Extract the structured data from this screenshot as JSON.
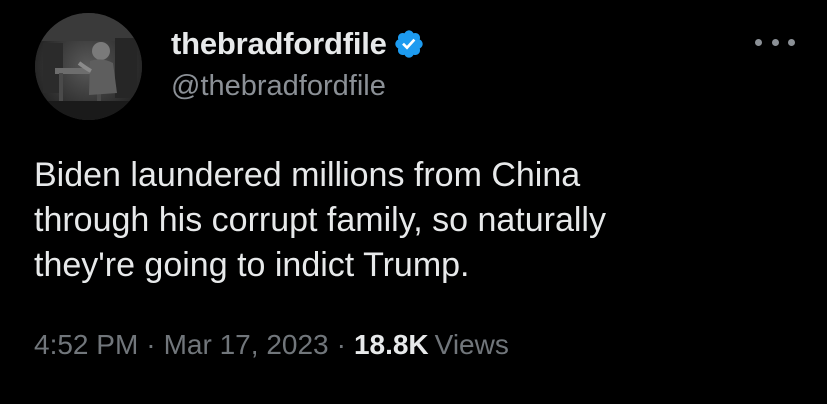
{
  "user": {
    "display_name": "thebradfordfile",
    "handle": "@thebradfordfile",
    "verified": true,
    "avatar_icon": "profile-photo",
    "verified_color": "#1d9bf0"
  },
  "tweet": {
    "text": "Biden laundered millions from China\nthrough his corrupt family, so naturally\nthey're going to indict Trump."
  },
  "meta": {
    "time": "4:52 PM",
    "separator": "·",
    "date": "Mar 17, 2023",
    "views_count": "18.8K",
    "views_label": "Views"
  },
  "menu": {
    "icon": "more-options-icon"
  }
}
